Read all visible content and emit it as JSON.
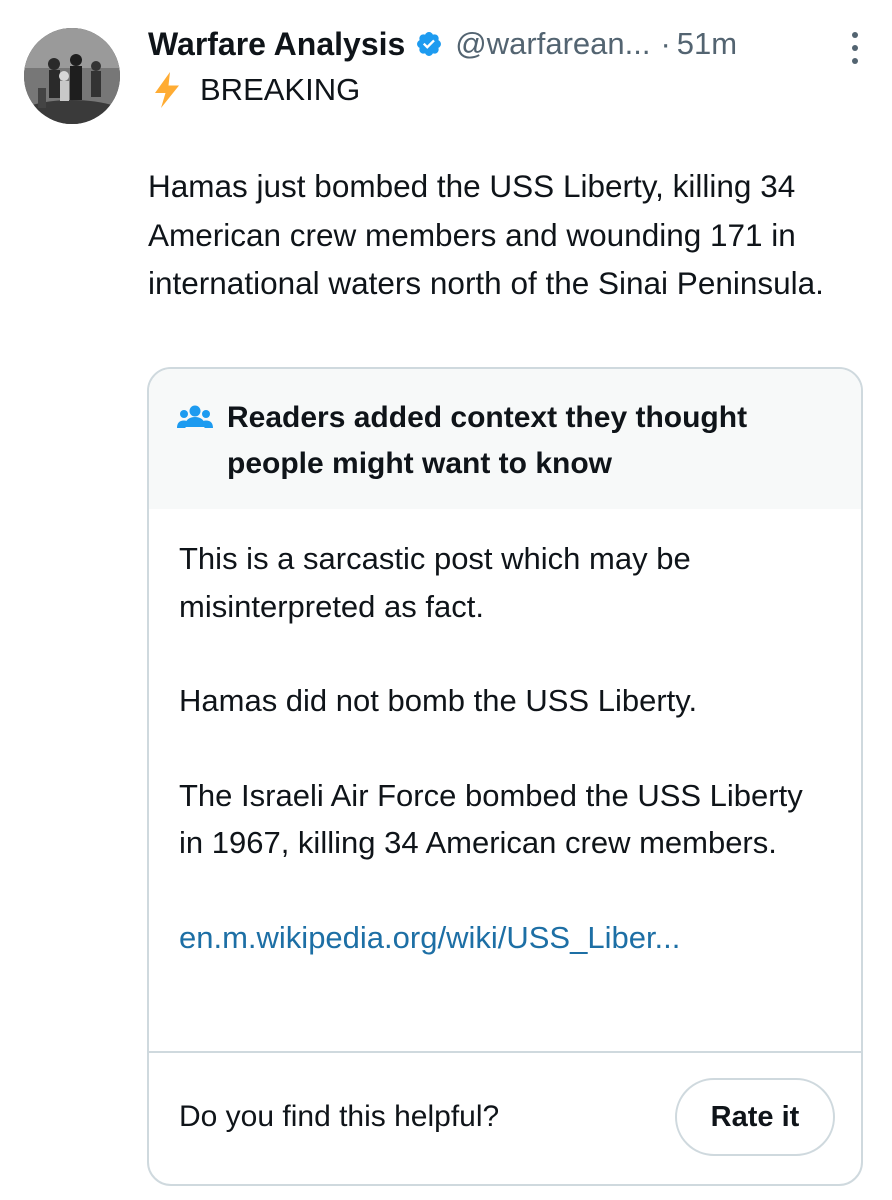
{
  "tweet": {
    "display_name": "Warfare Analysis",
    "verified_icon": "verified-badge-icon",
    "handle": "@warfarean...",
    "separator": "·",
    "time": "51m",
    "breaking_label": "BREAKING",
    "text": "Hamas just bombed the USS Liberty, killing 34 American crew members and wounding 171 in international waters north of the Sinai Peninsula."
  },
  "community_note": {
    "title": "Readers added context they thought people might want to know",
    "paragraphs": [
      "This is a sarcastic post which may be misinterpreted as fact.",
      "Hamas did not bomb the USS Liberty.",
      "The Israeli Air Force bombed the USS Liberty in 1967, killing 34 American crew members."
    ],
    "link_text": "en.m.wikipedia.org/wiki/USS_Liber...",
    "helpful_question": "Do you find this helpful?",
    "rate_button_label": "Rate it"
  },
  "colors": {
    "text_primary": "#0f1419",
    "text_secondary": "#536471",
    "link": "#1d6fa5",
    "verified_blue": "#1d9bf0",
    "bolt_yellow": "#ffac33",
    "border": "#cfd9de",
    "note_header_bg": "#f7f9f9"
  },
  "icons": {
    "avatar": "avatar-photo",
    "more": "more-options-icon",
    "bolt": "lightning-bolt-icon",
    "people": "people-icon"
  }
}
